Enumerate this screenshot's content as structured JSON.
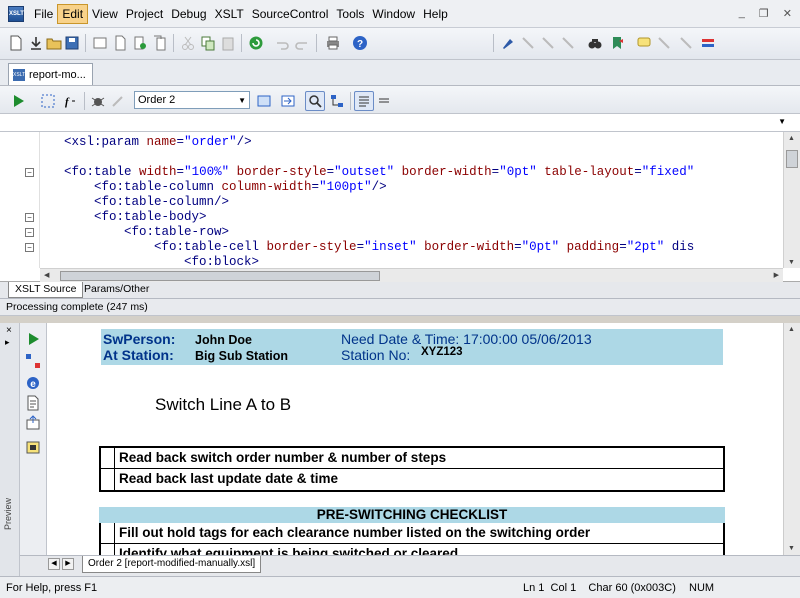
{
  "menu": {
    "app_icon_text": "XSLT",
    "items": [
      "File",
      "Edit",
      "View",
      "Project",
      "Debug",
      "XSLT",
      "SourceControl",
      "Tools",
      "Window",
      "Help"
    ],
    "active_index": 1
  },
  "window_controls": {
    "minimize": "_",
    "restore": "❐",
    "close": "✕"
  },
  "doc_tab": {
    "label": "report-mo..."
  },
  "xslt_toolbar": {
    "parameter_value": "Order 2",
    "combo_value": ""
  },
  "editor": {
    "lines": [
      {
        "text": "    <xsl:param name=\"order\"/>"
      },
      {
        "text": ""
      },
      {
        "text": "    <fo:table width=\"100%\" border-style=\"outset\" border-width=\"0pt\" table-layout=\"fixed\""
      },
      {
        "text": "        <fo:table-column column-width=\"100pt\"/>"
      },
      {
        "text": "        <fo:table-column/>"
      },
      {
        "text": "        <fo:table-body>"
      },
      {
        "text": "            <fo:table-row>"
      },
      {
        "text": "                <fo:table-cell border-style=\"inset\" border-width=\"0pt\" padding=\"2pt\" dis"
      },
      {
        "text": "                    <fo:block>"
      }
    ]
  },
  "source_tabs": [
    {
      "label": "XSLT Source",
      "active": true
    },
    {
      "label": "Params/Other",
      "active": false
    }
  ],
  "processing_status": "Processing complete  (247 ms)",
  "preview": {
    "side_label": "Preview",
    "header": {
      "swperson_label": "SwPerson:",
      "swperson_value": "John Doe",
      "station_label": "At Station:",
      "station_value": "Big Sub Station",
      "need_date_label": "Need Date & Time: 17:00:00 05/06/2013",
      "station_no_label": "Station No:",
      "station_no_value": "XYZ123"
    },
    "switch_title": "Switch Line A to B",
    "readback_rows": [
      "Read back switch order number & number of steps",
      "Read back last update date & time"
    ],
    "checklist_title": "PRE-SWITCHING CHECKLIST",
    "checklist_rows": [
      "Fill out hold tags for each clearance number listed on the switching order",
      "Identify what equipment is being switched or cleared"
    ],
    "tab_label": "Order 2 [report-modified-manually.xsl]"
  },
  "status": {
    "help": "For Help, press F1",
    "position": "Ln 1  Col 1    Char 60 (0x003C)",
    "num": "NUM"
  },
  "colors": {
    "header_fill": "#add8e6",
    "header_label_text": "#00338a",
    "active_menu": "#f8d28a",
    "xml_tag": "#000080",
    "xml_attr": "#8b0000",
    "xml_string": "#0000ff"
  }
}
